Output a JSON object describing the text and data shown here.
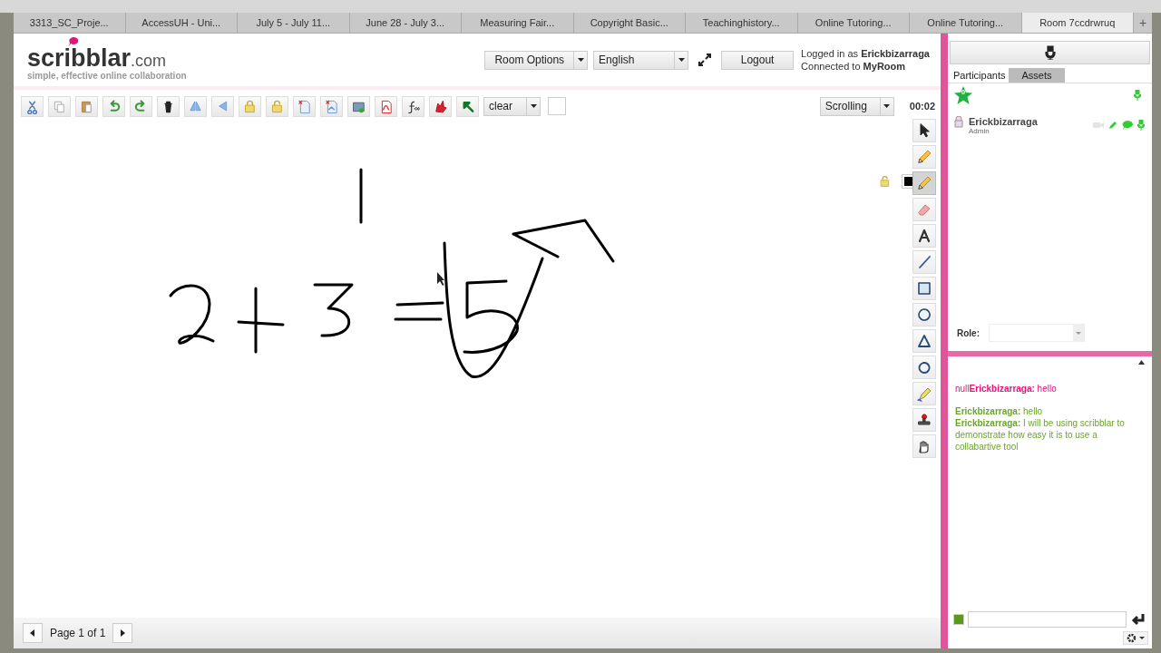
{
  "browser_tabs": [
    {
      "label": "3313_SC_Proje...",
      "selected": false
    },
    {
      "label": "AccessUH - Uni...",
      "selected": false
    },
    {
      "label": "July 5 - July 11...",
      "selected": false
    },
    {
      "label": "June 28 - July 3...",
      "selected": false
    },
    {
      "label": "Measuring Fair...",
      "selected": false
    },
    {
      "label": "Copyright Basic...",
      "selected": false
    },
    {
      "label": "Teachinghistory...",
      "selected": false
    },
    {
      "label": "Online Tutoring...",
      "selected": false
    },
    {
      "label": "Online Tutoring...",
      "selected": false
    },
    {
      "label": "Room 7ccdrwruq",
      "selected": true
    }
  ],
  "new_tab": "+",
  "logo": {
    "name": "scribblar",
    "domain": ".com",
    "tagline": "simple, effective online collaboration"
  },
  "header": {
    "room_options": "Room Options",
    "language": "English",
    "logout": "Logout",
    "login_line": "Logged in as **Erickbizarraga**",
    "room_line": "Connected to **MyRoom**"
  },
  "toolbar": {
    "tools": [
      {
        "kind": "cut"
      },
      {
        "kind": "copy"
      },
      {
        "kind": "paste"
      },
      {
        "kind": "undo"
      },
      {
        "kind": "redo"
      },
      {
        "kind": "delete"
      },
      {
        "kind": "flip"
      },
      {
        "kind": "back"
      },
      {
        "kind": "lock"
      },
      {
        "kind": "unlock"
      },
      {
        "kind": "import"
      },
      {
        "kind": "export"
      },
      {
        "kind": "snapshot"
      },
      {
        "kind": "pdf"
      },
      {
        "kind": "formula"
      },
      {
        "kind": "shape"
      },
      {
        "kind": "arrow"
      }
    ],
    "clear": "clear",
    "mode": "Scrolling",
    "timer": "00:02"
  },
  "side_tools": [
    {
      "kind": "pointer",
      "selected": false
    },
    {
      "kind": "pencil",
      "selected": false
    },
    {
      "kind": "pencil",
      "selected": true
    },
    {
      "kind": "eraser",
      "selected": false
    },
    {
      "kind": "text",
      "selected": false
    },
    {
      "kind": "line",
      "selected": false
    },
    {
      "kind": "rectangle",
      "selected": false
    },
    {
      "kind": "ellipse",
      "selected": false
    },
    {
      "kind": "triangle",
      "selected": false
    },
    {
      "kind": "circle",
      "selected": false
    },
    {
      "kind": "highlighter",
      "selected": false
    },
    {
      "kind": "stamp",
      "selected": false
    },
    {
      "kind": "hand",
      "selected": false
    }
  ],
  "pager": {
    "label": "Page 1 of 1"
  },
  "panel": {
    "tabs": [
      {
        "label": "Participants",
        "selected": true
      },
      {
        "label": "Assets",
        "selected": false
      }
    ],
    "star_count": "0",
    "participants": [
      {
        "name": "Erickbizarraga",
        "role": "Admin"
      }
    ],
    "role_label": "Role:",
    "chat": [
      {
        "text": "null**Erickbizarraga:** hello",
        "color": "#e0147a"
      },
      {
        "text": "**Erickbizarraga:** hello",
        "color": "#6aa62a"
      },
      {
        "text": "**Erickbizarraga:** I will be using scribblar to demonstrate how easy it is to use a collabartive tool",
        "color": "#6aa62a"
      }
    ]
  }
}
